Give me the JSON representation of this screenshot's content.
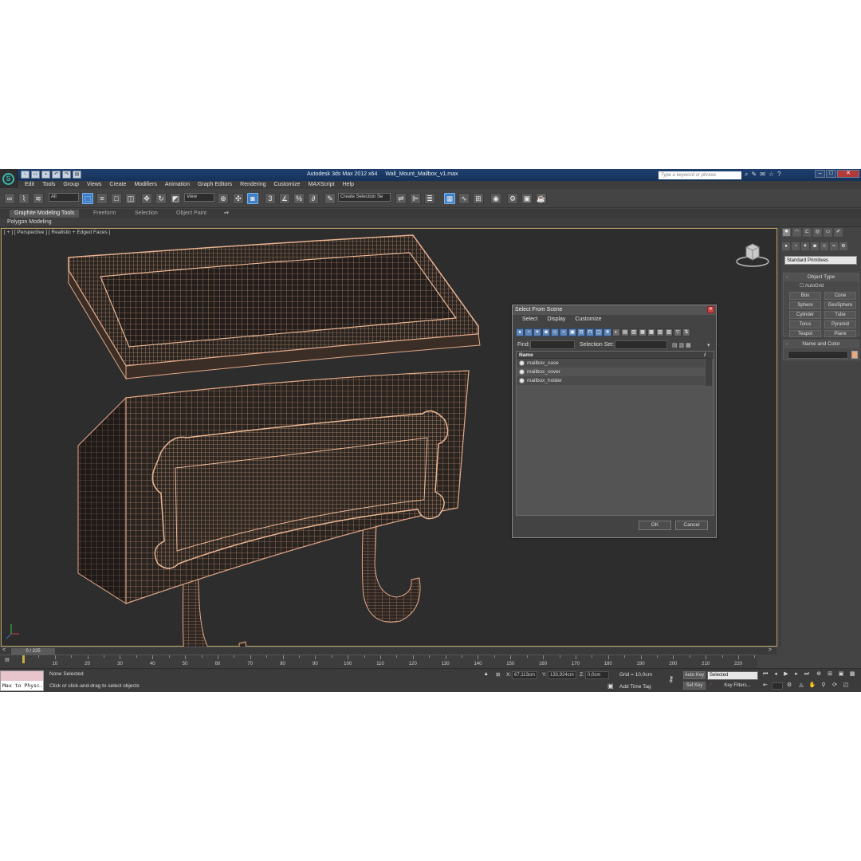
{
  "window": {
    "app_title": "Autodesk 3ds Max  2012 x64",
    "file_name": "Wall_Mount_Mailbox_v1.max",
    "search_placeholder": "Type a keyword or phrase"
  },
  "menu": [
    "Edit",
    "Tools",
    "Group",
    "Views",
    "Create",
    "Modifiers",
    "Animation",
    "Graph Editors",
    "Rendering",
    "Customize",
    "MAXScript",
    "Help"
  ],
  "toolbar": {
    "selection_filter": "All",
    "ref_coord": "View",
    "named_selection": "Create Selection Se"
  },
  "ribbon": {
    "tabs": [
      "Graphite Modeling Tools",
      "Freeform",
      "Selection",
      "Object Paint"
    ],
    "panel": "Polygon Modeling"
  },
  "viewport": {
    "label": "[ + ] [ Perspective ] [ Realistic + Edged Faces ]",
    "wire_color": "#e8b896"
  },
  "dialog": {
    "title": "Select From Scene",
    "menu": [
      "Select",
      "Display",
      "Customize"
    ],
    "find_label": "Find:",
    "selection_set_label": "Selection Set:",
    "column_header": "Name",
    "objects": [
      "mailbox_case",
      "mailbox_cover",
      "mailbox_holder"
    ],
    "ok_label": "OK",
    "cancel_label": "Cancel"
  },
  "command_panel": {
    "category": "Standard Primitives",
    "object_type_title": "Object Type",
    "autogrid_label": "AutoGrid",
    "primitives": [
      "Box",
      "Cone",
      "Sphere",
      "GeoSphere",
      "Cylinder",
      "Tube",
      "Torus",
      "Pyramid",
      "Teapot",
      "Plane"
    ],
    "name_color_title": "Name and Color",
    "object_color": "#e8a882"
  },
  "timeline": {
    "frame_indicator": "0 / 225",
    "ticks": [
      10,
      20,
      30,
      40,
      50,
      60,
      70,
      80,
      90,
      100,
      110,
      120,
      130,
      140,
      150,
      160,
      170,
      180,
      190,
      200,
      210,
      220
    ]
  },
  "status": {
    "maxscript_line": "Max to Physc.",
    "selection_status": "None Selected",
    "prompt": "Click or click-and-drag to select objects",
    "x_label": "X:",
    "x_value": "67,113cm",
    "y_label": "Y:",
    "y_value": "133,924cm",
    "z_label": "Z:",
    "z_value": "0,0cm",
    "grid": "Grid = 10,0cm",
    "add_time_tag": "Add Time Tag",
    "auto_key": "Auto Key",
    "auto_key_mode": "Selected",
    "set_key": "Set Key",
    "key_filters": "Key Filters..."
  }
}
